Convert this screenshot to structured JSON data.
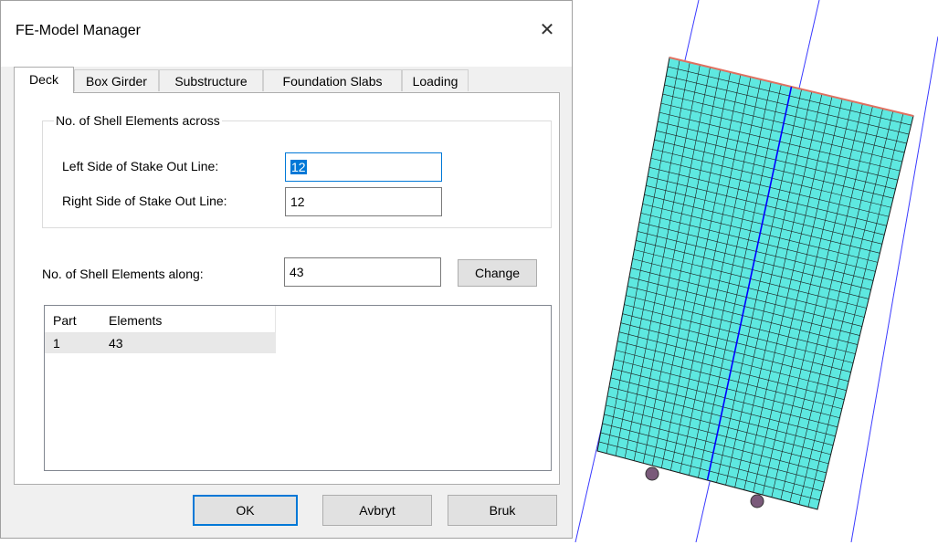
{
  "dialog": {
    "title": "FE-Model Manager",
    "close_glyph": "✕",
    "tabs": [
      "Deck",
      "Box Girder",
      "Substructure",
      "Foundation Slabs",
      "Loading"
    ],
    "active_tab": "Deck"
  },
  "across": {
    "group_label": "No. of Shell Elements across",
    "left_label": "Left Side of Stake Out Line:",
    "left_value": "12",
    "right_label": "Right Side of Stake Out Line:",
    "right_value": "12"
  },
  "along": {
    "label": "No. of Shell Elements along:",
    "value": "43",
    "change_button": "Change"
  },
  "parts_list": {
    "columns": [
      "Part",
      "Elements"
    ],
    "rows": [
      [
        "1",
        "43"
      ]
    ]
  },
  "buttons": {
    "ok": "OK",
    "cancel": "Avbryt",
    "apply": "Bruk"
  },
  "model_view": {
    "mesh_color": "#5ee8e0",
    "grid_line_color": "#1a1a1a",
    "guide_line_color": "#3a3aff",
    "centre_line_color": "#0000ff",
    "top_edge_color": "#e07060",
    "support_color": "#7a5a7a",
    "cells_across": 24,
    "cells_along": 43
  }
}
